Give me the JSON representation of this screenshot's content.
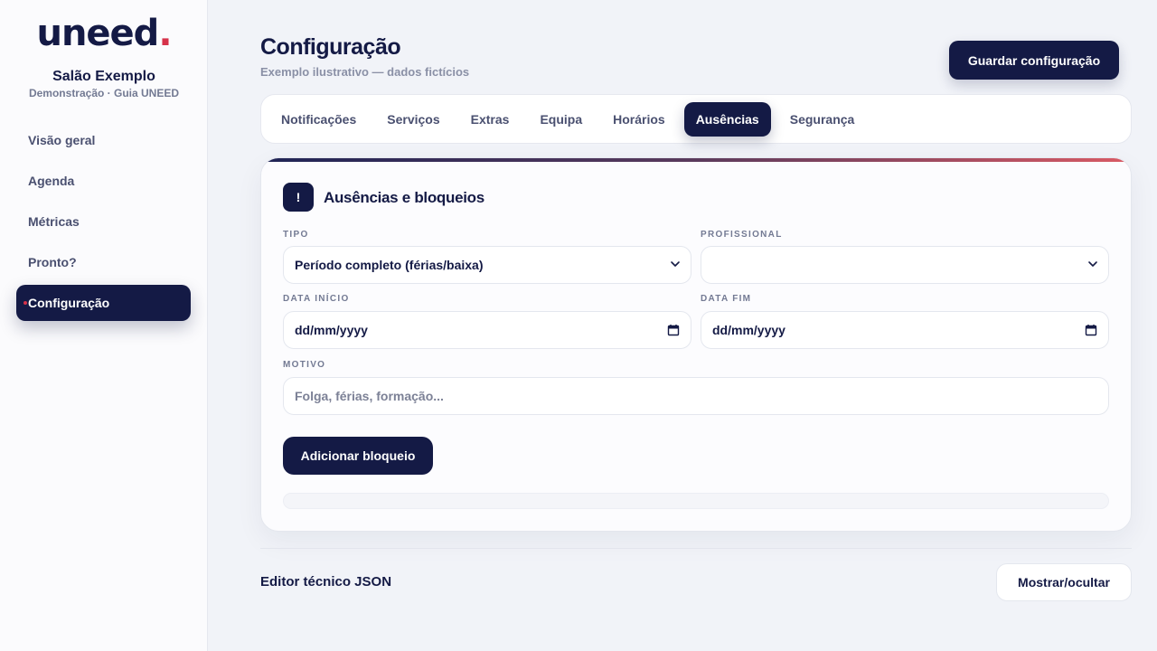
{
  "sidebar": {
    "logo_text": "uneed",
    "logo_dot": ".",
    "brand_name": "Salão Exemplo",
    "brand_sub": "Demonstração · Guia UNEED",
    "items": [
      {
        "label": "Visão geral"
      },
      {
        "label": "Agenda"
      },
      {
        "label": "Métricas"
      },
      {
        "label": "Pronto?"
      },
      {
        "label": "Configuração",
        "active": true
      }
    ]
  },
  "header": {
    "title": "Configuração",
    "subtitle": "Exemplo ilustrativo — dados fictícios",
    "save_label": "Guardar configuração"
  },
  "tabs": [
    {
      "label": "Notificações"
    },
    {
      "label": "Serviços"
    },
    {
      "label": "Extras"
    },
    {
      "label": "Equipa"
    },
    {
      "label": "Horários"
    },
    {
      "label": "Ausências",
      "active": true
    },
    {
      "label": "Segurança"
    }
  ],
  "card": {
    "icon_glyph": "!",
    "title": "Ausências e bloqueios",
    "tipo_label": "TIPO",
    "tipo_value": "Período completo (férias/baixa)",
    "profissional_label": "PROFISSIONAL",
    "profissional_value": "",
    "data_inicio_label": "DATA INÍCIO",
    "data_inicio_value": "dd/mm/yyyy",
    "data_fim_label": "DATA FIM",
    "data_fim_value": "dd/mm/yyyy",
    "motivo_label": "MOTIVO",
    "motivo_placeholder": "Folga, férias, formação...",
    "add_label": "Adicionar bloqueio"
  },
  "json_editor": {
    "title": "Editor técnico JSON",
    "toggle_label": "Mostrar/ocultar"
  },
  "colors": {
    "primary": "#141a45",
    "accent": "#d6324a"
  }
}
